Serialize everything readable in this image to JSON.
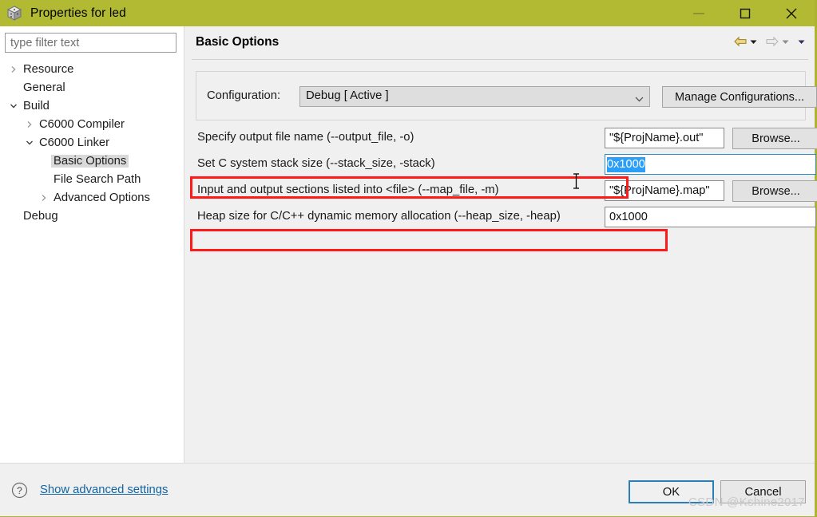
{
  "window": {
    "title": "Properties for led",
    "icon": "cube-icon",
    "titlebar_color": "#b2ba33",
    "controls": [
      {
        "name": "minimize",
        "glyph": "minimize-icon"
      },
      {
        "name": "maximize",
        "glyph": "maximize-icon"
      },
      {
        "name": "close",
        "glyph": "close-icon"
      }
    ]
  },
  "sidebar": {
    "filter": {
      "value": "",
      "placeholder": "type filter text"
    },
    "items": [
      {
        "label": "Resource",
        "indent": 0,
        "twisty": "collapsed",
        "selected": false
      },
      {
        "label": "General",
        "indent": 0,
        "twisty": "none",
        "selected": false
      },
      {
        "label": "Build",
        "indent": 0,
        "twisty": "expanded",
        "selected": false
      },
      {
        "label": "C6000 Compiler",
        "indent": 1,
        "twisty": "collapsed",
        "selected": false
      },
      {
        "label": "C6000 Linker",
        "indent": 1,
        "twisty": "expanded",
        "selected": false
      },
      {
        "label": "Basic Options",
        "indent": 2,
        "twisty": "none",
        "selected": true
      },
      {
        "label": "File Search Path",
        "indent": 2,
        "twisty": "none",
        "selected": false
      },
      {
        "label": "Advanced Options",
        "indent": 2,
        "twisty": "collapsed",
        "selected": false
      },
      {
        "label": "Debug",
        "indent": 0,
        "twisty": "none",
        "selected": false
      }
    ]
  },
  "content": {
    "title": "Basic Options",
    "nav": {
      "back": "back-arrow-icon",
      "back_menu": "chevron-down-icon",
      "forward": "forward-arrow-icon",
      "forward_menu": "chevron-down-icon",
      "view_menu": "chevron-down-icon"
    },
    "configuration": {
      "label": "Configuration:",
      "value": "Debug  [ Active ]",
      "manage_button": "Manage Configurations..."
    },
    "options": [
      {
        "label": "Specify output file name (--output_file, -o)",
        "value": "\"${ProjName}.out\"",
        "button": "Browse...",
        "highlighted": false,
        "focused": false
      },
      {
        "label": "Set C system stack size (--stack_size, -stack)",
        "value": "0x1000",
        "button": "",
        "highlighted": true,
        "focused": true
      },
      {
        "label": "Input and output sections listed into <file> (--map_file, -m)",
        "value": "\"${ProjName}.map\"",
        "button": "Browse...",
        "highlighted": false,
        "focused": false
      },
      {
        "label": "Heap size for C/C++ dynamic memory allocation (--heap_size, -heap)",
        "value": "0x1000",
        "button": "",
        "highlighted": true,
        "focused": false
      }
    ]
  },
  "footer": {
    "help_icon": "question-mark-icon",
    "advanced_link": "Show advanced settings",
    "ok_button": "OK",
    "cancel_button": "Cancel"
  },
  "watermark": "CSDN @Kshine2017",
  "colors": {
    "titlebar": "#b2ba33",
    "annotation": "#ff1a1a",
    "selection": "#2b9ef7",
    "link": "#1464a0",
    "focus_border": "#2a7fb8"
  }
}
